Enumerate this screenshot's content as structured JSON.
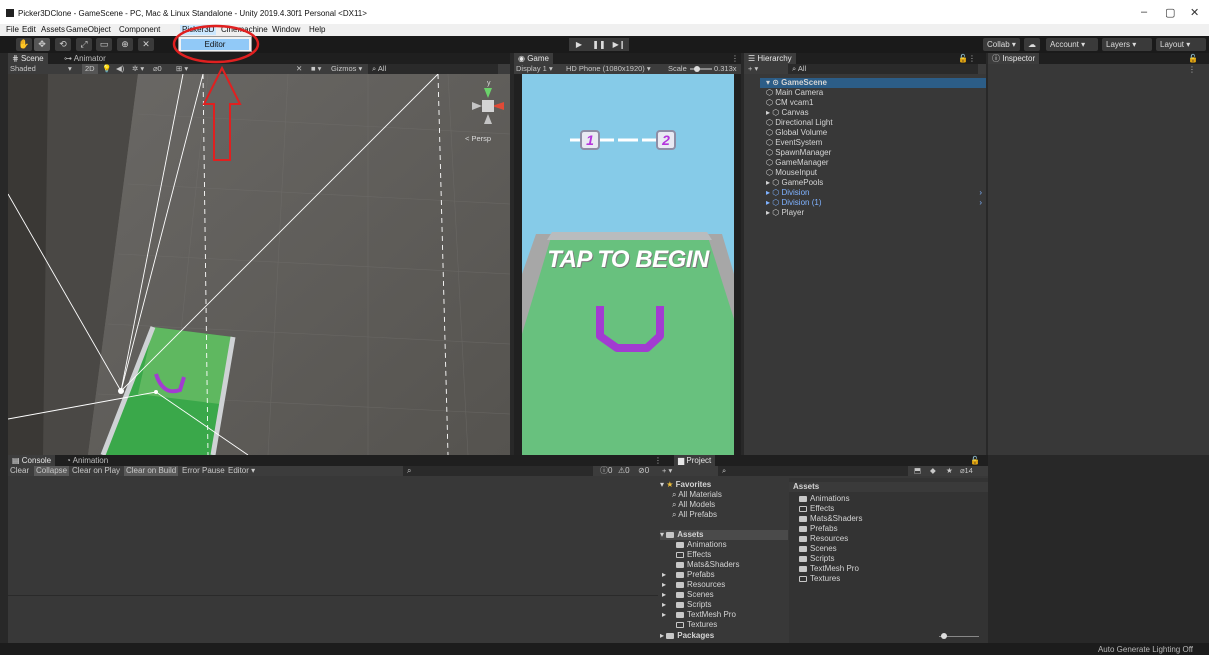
{
  "window": {
    "title": "Picker3DClone - GameScene - PC, Mac & Linux Standalone - Unity 2019.4.30f1 Personal <DX11>",
    "controls": [
      "–",
      "▢",
      "✕"
    ]
  },
  "menu": {
    "items": [
      "File",
      "Edit",
      "Assets",
      "GameObject",
      "Component",
      "Picker3D",
      "Cinemachine",
      "Window",
      "Help"
    ],
    "open_menu": "Picker3D",
    "dropdown_items": [
      "Editor"
    ]
  },
  "toolbar": {
    "tools": [
      "✋",
      "✥",
      "⟲",
      "⤢",
      "▭",
      "⊕",
      "✕"
    ],
    "play": "▶",
    "pause": "❚❚",
    "step": "▶❙",
    "collab": "Collab ▾",
    "cloud": "☁",
    "account": "Account",
    "layers": "Layers",
    "layout": "Layout"
  },
  "scene": {
    "tabs": [
      "Scene",
      "Animator"
    ],
    "shading": "Shaded",
    "mode_2d": "2D",
    "gizmos": "Gizmos",
    "search_placeholder": "All",
    "persp_label": "< Persp",
    "gizmo_y": "y"
  },
  "game": {
    "tab": "Game",
    "display": "Display 1",
    "resolution": "HD Phone (1080x1920)",
    "scale_label": "Scale",
    "scale_value": "0.313x",
    "level_current": "1",
    "level_next": "2",
    "prompt": "TAP TO BEGIN"
  },
  "hierarchy": {
    "tab": "Hierarchy",
    "search_placeholder": "All",
    "scene_name": "GameScene",
    "items": [
      {
        "label": "Main Camera",
        "blue": false,
        "arrow": false
      },
      {
        "label": "CM vcam1",
        "blue": false,
        "arrow": false
      },
      {
        "label": "Canvas",
        "blue": false,
        "arrow": true
      },
      {
        "label": "Directional Light",
        "blue": false,
        "arrow": false
      },
      {
        "label": "Global Volume",
        "blue": false,
        "arrow": false
      },
      {
        "label": "EventSystem",
        "blue": false,
        "arrow": false
      },
      {
        "label": "SpawnManager",
        "blue": false,
        "arrow": false
      },
      {
        "label": "GameManager",
        "blue": false,
        "arrow": false
      },
      {
        "label": "MouseInput",
        "blue": false,
        "arrow": false
      },
      {
        "label": "GamePools",
        "blue": false,
        "arrow": true
      },
      {
        "label": "Division",
        "blue": true,
        "arrow": true
      },
      {
        "label": "Division (1)",
        "blue": true,
        "arrow": true
      },
      {
        "label": "Player",
        "blue": false,
        "arrow": true
      }
    ]
  },
  "inspector": {
    "tab": "Inspector"
  },
  "console": {
    "tabs": [
      "Console",
      "Animation"
    ],
    "buttons": [
      "Clear",
      "Collapse",
      "Clear on Play",
      "Clear on Build",
      "Error Pause",
      "Editor ▾"
    ],
    "counts": {
      "info": "0",
      "warn": "0",
      "error": "0"
    }
  },
  "project": {
    "tab": "Project",
    "favorites_header": "Favorites",
    "favorites": [
      "All Materials",
      "All Models",
      "All Prefabs"
    ],
    "assets_header": "Assets",
    "asset_tree": [
      {
        "label": "Animations",
        "filled": true,
        "arrow": false
      },
      {
        "label": "Effects",
        "filled": false,
        "arrow": false
      },
      {
        "label": "Mats&Shaders",
        "filled": true,
        "arrow": false
      },
      {
        "label": "Prefabs",
        "filled": true,
        "arrow": true
      },
      {
        "label": "Resources",
        "filled": true,
        "arrow": true
      },
      {
        "label": "Scenes",
        "filled": true,
        "arrow": true
      },
      {
        "label": "Scripts",
        "filled": true,
        "arrow": true
      },
      {
        "label": "TextMesh Pro",
        "filled": true,
        "arrow": true
      },
      {
        "label": "Textures",
        "filled": false,
        "arrow": false
      }
    ],
    "packages_header": "Packages",
    "right_header": "Assets",
    "right_items": [
      {
        "label": "Animations",
        "filled": true
      },
      {
        "label": "Effects",
        "filled": false
      },
      {
        "label": "Mats&Shaders",
        "filled": true
      },
      {
        "label": "Prefabs",
        "filled": true
      },
      {
        "label": "Resources",
        "filled": true
      },
      {
        "label": "Scenes",
        "filled": true
      },
      {
        "label": "Scripts",
        "filled": true
      },
      {
        "label": "TextMesh Pro",
        "filled": true
      },
      {
        "label": "Textures",
        "filled": false
      }
    ],
    "hidden_count": "14"
  },
  "status": {
    "text": "Auto Generate Lighting Off"
  },
  "colors": {
    "accent": "#2c5d87",
    "annotation": "#e02020",
    "level_text": "#b535dd",
    "game_sky": "#7fc7e9",
    "game_floor": "#67c07c"
  }
}
